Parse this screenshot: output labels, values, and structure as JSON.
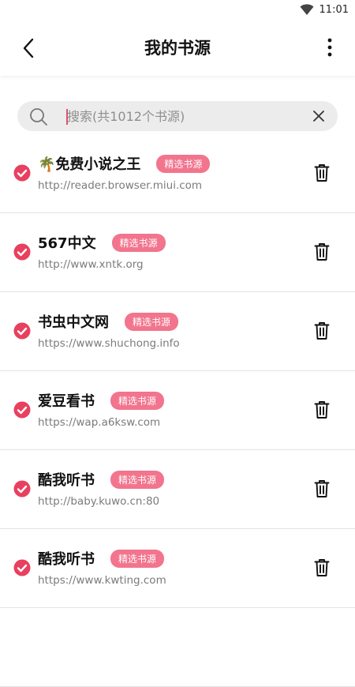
{
  "status_bar": {
    "time": "11:01"
  },
  "header": {
    "title": "我的书源"
  },
  "search": {
    "placeholder": "搜索(共1012个书源)",
    "value": ""
  },
  "sources": [
    {
      "name": "🌴免费小说之王",
      "badge": "精选书源",
      "url": "http://reader.browser.miui.com"
    },
    {
      "name": "567中文",
      "badge": "精选书源",
      "url": "http://www.xntk.org"
    },
    {
      "name": "书虫中文网",
      "badge": "精选书源",
      "url": "https://www.shuchong.info"
    },
    {
      "name": "爱豆看书",
      "badge": "精选书源",
      "url": "https://wap.a6ksw.com"
    },
    {
      "name": "酷我听书",
      "badge": "精选书源",
      "url": "http://baby.kuwo.cn:80"
    },
    {
      "name": "酷我听书",
      "badge": "精选书源",
      "url": "https://www.kwting.com"
    },
    {
      "name": "",
      "badge": "",
      "url": ""
    }
  ],
  "colors": {
    "accent": "#e8405f",
    "badge_bg": "#f2748d"
  }
}
